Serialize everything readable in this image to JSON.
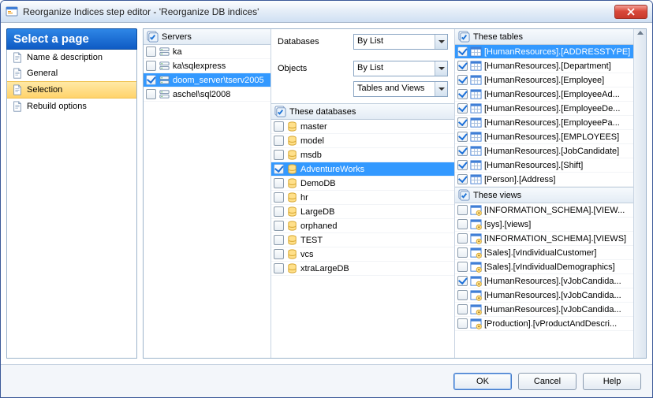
{
  "window": {
    "title": "Reorganize Indices step editor - 'Reorganize DB indices'"
  },
  "sidebar": {
    "header": "Select a page",
    "items": [
      {
        "label": "Name & description"
      },
      {
        "label": "General"
      },
      {
        "label": "Selection"
      },
      {
        "label": "Rebuild options"
      }
    ],
    "selectedIndex": 2
  },
  "servers": {
    "header": "Servers",
    "items": [
      {
        "label": "ka",
        "checked": false
      },
      {
        "label": "ka\\sqlexpress",
        "checked": false
      },
      {
        "label": "doom_server\\tserv2005",
        "checked": true,
        "selected": true
      },
      {
        "label": "aschel\\sql2008",
        "checked": false
      }
    ]
  },
  "filters": {
    "databasesLabel": "Databases",
    "databasesValue": "By List",
    "objectsLabel": "Objects",
    "objectsValue": "By List",
    "objectTypeValue": "Tables and Views"
  },
  "databases": {
    "header": "These databases",
    "items": [
      {
        "label": "master",
        "checked": false
      },
      {
        "label": "model",
        "checked": false
      },
      {
        "label": "msdb",
        "checked": false
      },
      {
        "label": "AdventureWorks",
        "checked": true,
        "selected": true
      },
      {
        "label": "DemoDB",
        "checked": false
      },
      {
        "label": "hr",
        "checked": false
      },
      {
        "label": "LargeDB",
        "checked": false
      },
      {
        "label": "orphaned",
        "checked": false
      },
      {
        "label": "TEST",
        "checked": false
      },
      {
        "label": "vcs",
        "checked": false
      },
      {
        "label": "xtraLargeDB",
        "checked": false
      }
    ]
  },
  "tables": {
    "header": "These tables",
    "items": [
      {
        "label": "[HumanResources].[ADDRESSTYPE]",
        "checked": true,
        "selected": true
      },
      {
        "label": "[HumanResources].[Department]",
        "checked": true
      },
      {
        "label": "[HumanResources].[Employee]",
        "checked": true
      },
      {
        "label": "[HumanResources].[EmployeeAd...",
        "checked": true
      },
      {
        "label": "[HumanResources].[EmployeeDe...",
        "checked": true
      },
      {
        "label": "[HumanResources].[EmployeePa...",
        "checked": true
      },
      {
        "label": "[HumanResources].[EMPLOYEES]",
        "checked": true
      },
      {
        "label": "[HumanResources].[JobCandidate]",
        "checked": true
      },
      {
        "label": "[HumanResources].[Shift]",
        "checked": true
      },
      {
        "label": "[Person].[Address]",
        "checked": true
      }
    ]
  },
  "views": {
    "header": "These views",
    "items": [
      {
        "label": "[INFORMATION_SCHEMA].[VIEW...",
        "checked": false
      },
      {
        "label": "[sys].[views]",
        "checked": false
      },
      {
        "label": "[INFORMATION_SCHEMA].[VIEWS]",
        "checked": false
      },
      {
        "label": "[Sales].[vIndividualCustomer]",
        "checked": false
      },
      {
        "label": "[Sales].[vIndividualDemographics]",
        "checked": false
      },
      {
        "label": "[HumanResources].[vJobCandida...",
        "checked": true
      },
      {
        "label": "[HumanResources].[vJobCandida...",
        "checked": false
      },
      {
        "label": "[HumanResources].[vJobCandida...",
        "checked": false
      },
      {
        "label": "[Production].[vProductAndDescri...",
        "checked": false
      }
    ]
  },
  "buttons": {
    "ok": "OK",
    "cancel": "Cancel",
    "help": "Help"
  }
}
